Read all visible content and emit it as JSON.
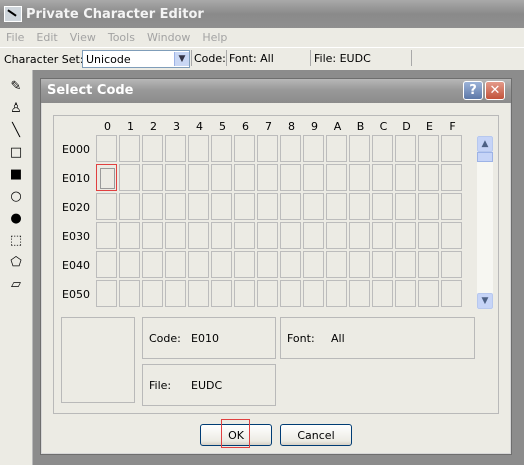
{
  "app": {
    "title": "Private Character Editor",
    "menu": [
      "File",
      "Edit",
      "View",
      "Tools",
      "Window",
      "Help"
    ],
    "character_set_label": "Character Set:",
    "character_set_value": "Unicode",
    "code_label": "Code:",
    "font_status": "Font: All",
    "file_status": "File: EUDC",
    "tools": [
      "pencil-icon",
      "brush-icon",
      "line-icon",
      "hollow-rectangle-icon",
      "filled-rectangle-icon",
      "hollow-ellipse-icon",
      "filled-ellipse-icon",
      "rectangular-selection-icon",
      "freeform-selection-icon",
      "eraser-icon"
    ]
  },
  "dialog": {
    "title": "Select Code",
    "help_label": "?",
    "close_label": "✕",
    "columns": [
      "0",
      "1",
      "2",
      "3",
      "4",
      "5",
      "6",
      "7",
      "8",
      "9",
      "A",
      "B",
      "C",
      "D",
      "E",
      "F"
    ],
    "rows": [
      "E000",
      "E010",
      "E020",
      "E030",
      "E040",
      "E050"
    ],
    "selected": {
      "row": "E010",
      "column": "0"
    },
    "code_label": "Code:",
    "code_value": "E010",
    "font_label": "Font:",
    "font_value": "All",
    "file_label": "File:",
    "file_value": "EUDC",
    "ok_label": "OK",
    "cancel_label": "Cancel",
    "colors": {
      "title_bar": "#999999",
      "dialog_bg": "#ecebe4",
      "highlight": "#e04040",
      "close_button": "#c2533b"
    }
  }
}
